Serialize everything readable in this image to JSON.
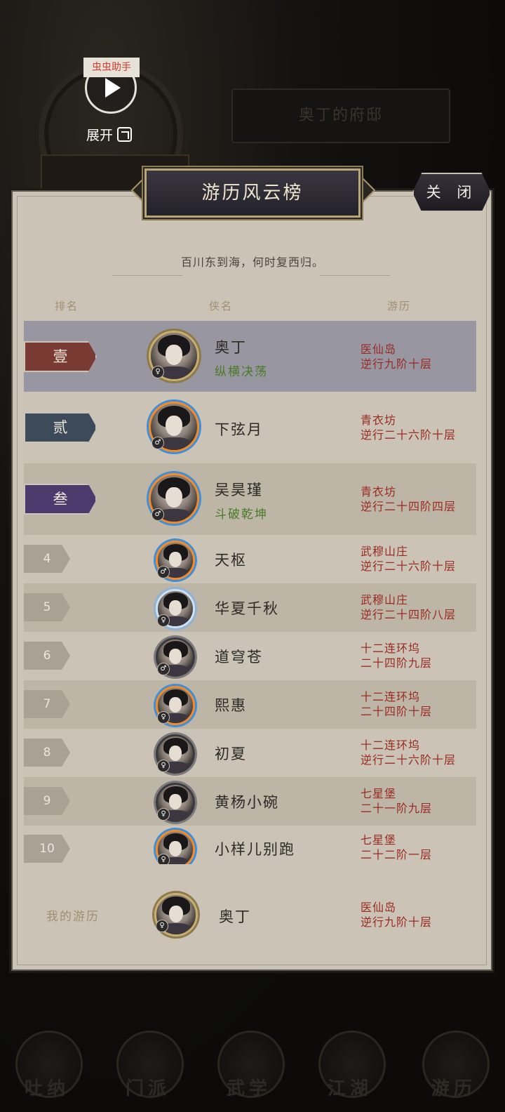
{
  "overlay": {
    "tag_label": "虫虫助手",
    "expand_label": "展开"
  },
  "background": {
    "banner_text": "奥丁的府邸"
  },
  "panel": {
    "title": "游历风云榜",
    "close_label": "关 闭",
    "motto": "百川东到海，何时复西归。",
    "headers": {
      "rank": "排名",
      "name": "侠名",
      "journey": "游历"
    }
  },
  "rows": [
    {
      "rank": "壹",
      "name": "奥丁",
      "sub": "纵横决荡",
      "place": "医仙岛",
      "stage": "逆行九阶十层",
      "badge_color": "#7a3a34",
      "gender": "♀"
    },
    {
      "rank": "贰",
      "name": "下弦月",
      "sub": "",
      "place": "青衣坊",
      "stage": "逆行二十六阶十层",
      "badge_color": "#3d4a5a",
      "gender": "♂"
    },
    {
      "rank": "叁",
      "name": "吴昊瑾",
      "sub": "斗破乾坤",
      "place": "青衣坊",
      "stage": "逆行二十四阶四层",
      "badge_color": "#4c3a6c",
      "gender": "♂"
    },
    {
      "rank": "4",
      "name": "天枢",
      "sub": "",
      "place": "武穆山庄",
      "stage": "逆行二十六阶十层",
      "gender": "♂"
    },
    {
      "rank": "5",
      "name": "华夏千秋",
      "sub": "",
      "place": "武穆山庄",
      "stage": "逆行二十四阶八层",
      "gender": "♀"
    },
    {
      "rank": "6",
      "name": "道穹苍",
      "sub": "",
      "place": "十二连环坞",
      "stage": "二十四阶九层",
      "gender": "♂"
    },
    {
      "rank": "7",
      "name": "熙惠",
      "sub": "",
      "place": "十二连环坞",
      "stage": "二十四阶十层",
      "gender": "♀"
    },
    {
      "rank": "8",
      "name": "初夏",
      "sub": "",
      "place": "十二连环坞",
      "stage": "逆行二十六阶十层",
      "gender": "♀"
    },
    {
      "rank": "9",
      "name": "黄杨小碗",
      "sub": "",
      "place": "七星堡",
      "stage": "二十一阶九层",
      "gender": "♀"
    },
    {
      "rank": "10",
      "name": "小样儿别跑",
      "sub": "",
      "place": "七星堡",
      "stage": "二十二阶一层",
      "gender": "♀"
    }
  ],
  "my_entry": {
    "label": "我的游历",
    "name": "奥丁",
    "place": "医仙岛",
    "stage": "逆行九阶十层",
    "gender": "♀"
  },
  "tabs": [
    "吐纳",
    "门派",
    "武学",
    "江湖",
    "游历"
  ]
}
